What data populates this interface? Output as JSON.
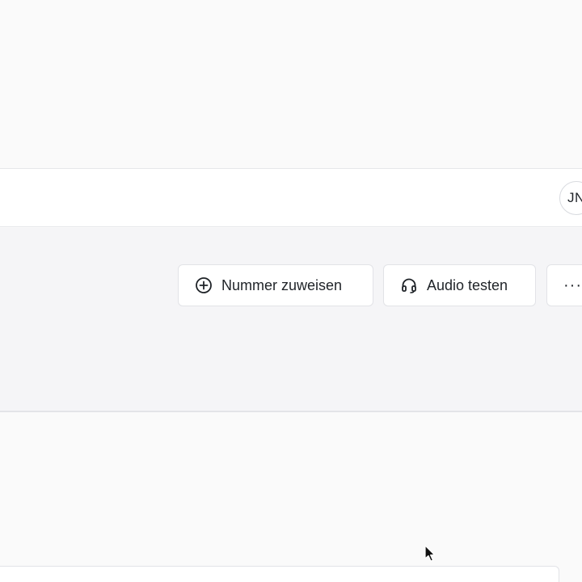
{
  "header": {
    "avatar_initials": "JN"
  },
  "actions": {
    "assign_number_label": "Nummer zuweisen",
    "assign_number_icon": "plus-circle-icon",
    "test_audio_label": "Audio testen",
    "test_audio_icon": "headset-icon",
    "more_label": "···"
  }
}
